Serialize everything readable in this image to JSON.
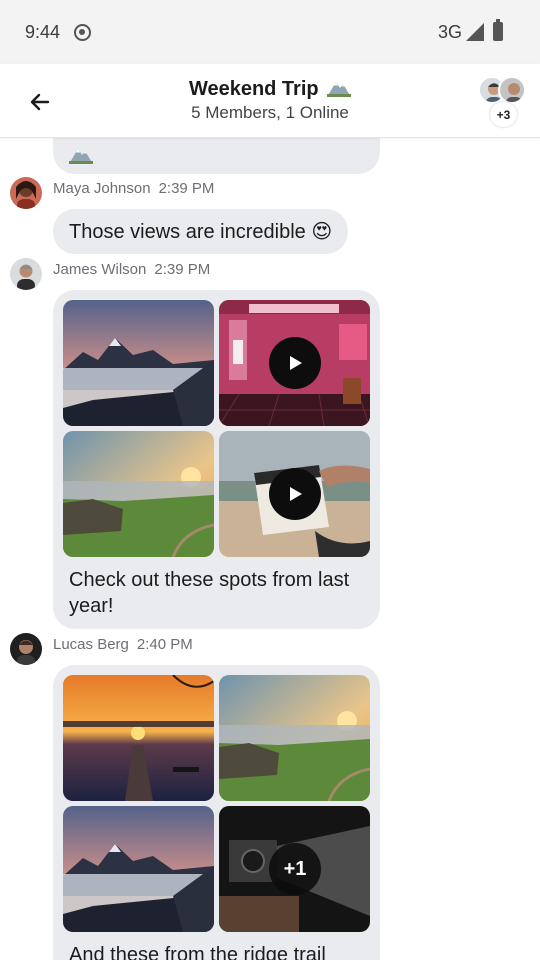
{
  "status_bar": {
    "time": "9:44",
    "network": "3G"
  },
  "header": {
    "title": "Weekend Trip",
    "subtitle": "5 Members, 1 Online",
    "members_overflow": "+3"
  },
  "messages": [
    {
      "sender": "Maya Johnson",
      "time": "2:39 PM",
      "text": "Those views are incredible 😍"
    },
    {
      "sender": "James Wilson",
      "time": "2:39 PM",
      "caption": "Check out these spots from last year!",
      "media": [
        {
          "kind": "image",
          "name": "mountain-sunset-photo"
        },
        {
          "kind": "video",
          "name": "cinema-video"
        },
        {
          "kind": "image",
          "name": "cliff-sunrise-photo"
        },
        {
          "kind": "video",
          "name": "clapperboard-video"
        }
      ]
    },
    {
      "sender": "Lucas Berg",
      "time": "2:40 PM",
      "caption": "And these from the ridge trail",
      "more_count": "+1",
      "media": [
        {
          "kind": "image",
          "name": "lake-sunset-photo"
        },
        {
          "kind": "image",
          "name": "cliff-sunrise-photo"
        },
        {
          "kind": "image",
          "name": "mountain-sunset-photo"
        },
        {
          "kind": "video",
          "name": "projector-video"
        }
      ]
    }
  ],
  "colors": {
    "bubble": "#e9ebee",
    "meta": "#6b6f75",
    "header_bg": "#ffffff",
    "status_bg": "#f3f3f3"
  }
}
